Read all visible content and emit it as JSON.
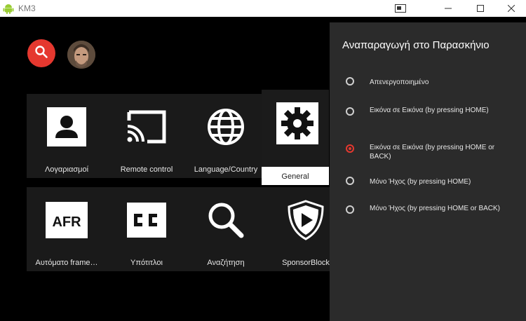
{
  "window": {
    "title": "KM3",
    "icons": [
      "android-icon",
      "window-mode-icon",
      "minimize-icon",
      "maximize-icon",
      "close-icon"
    ]
  },
  "header": {
    "search_icon": "search-icon",
    "accent_color": "#e5382f"
  },
  "tiles": [
    {
      "label": "Λογαριασμοί",
      "icon": "account-icon"
    },
    {
      "label": "Remote control",
      "icon": "cast-icon"
    },
    {
      "label": "Language/Country",
      "icon": "globe-icon"
    },
    {
      "label": "General",
      "icon": "gear-icon",
      "selected": true
    },
    {
      "label": "AFR",
      "caption": "Αυτόματο frame…",
      "icon": "afr-icon"
    },
    {
      "label": "Υπότιτλοι",
      "icon": "closed-captions-icon"
    },
    {
      "label": "Αναζήτηση",
      "icon": "search-icon"
    },
    {
      "label": "SponsorBlock",
      "icon": "sponsorblock-icon"
    }
  ],
  "panel": {
    "title": "Αναπαραγωγή στο Παρασκήνιο",
    "options": [
      {
        "label": "Απενεργοποιημένο",
        "checked": false
      },
      {
        "label": "Εικόνα σε Εικόνα (by pressing HOME)",
        "checked": false
      },
      {
        "label": "Εικόνα σε Εικόνα (by pressing HOME or BACK)",
        "checked": true
      },
      {
        "label": "Μόνο Ήχος (by pressing HOME)",
        "checked": false
      },
      {
        "label": "Μόνο Ήχος (by pressing HOME or BACK)",
        "checked": false
      }
    ]
  }
}
